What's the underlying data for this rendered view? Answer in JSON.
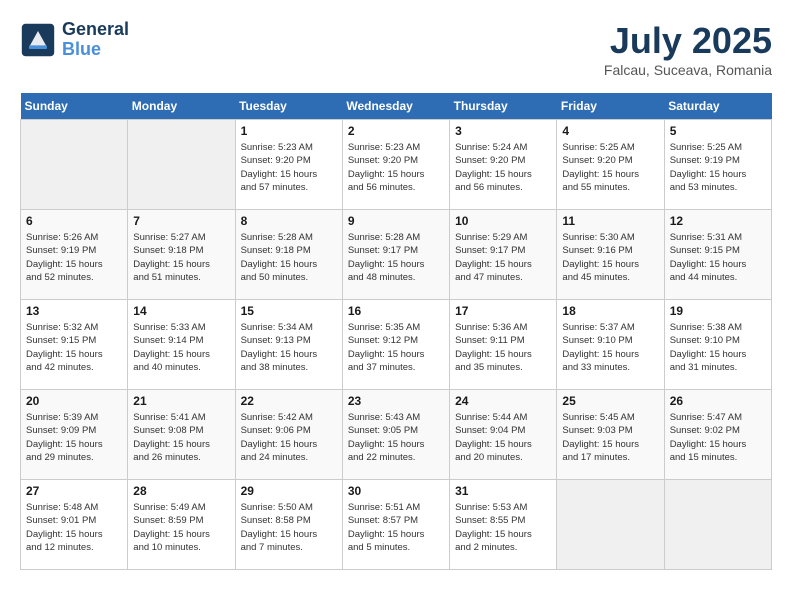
{
  "header": {
    "logo_line1": "General",
    "logo_line2": "Blue",
    "month": "July 2025",
    "location": "Falcau, Suceava, Romania"
  },
  "weekdays": [
    "Sunday",
    "Monday",
    "Tuesday",
    "Wednesday",
    "Thursday",
    "Friday",
    "Saturday"
  ],
  "weeks": [
    [
      {
        "day": "",
        "info": ""
      },
      {
        "day": "",
        "info": ""
      },
      {
        "day": "1",
        "info": "Sunrise: 5:23 AM\nSunset: 9:20 PM\nDaylight: 15 hours\nand 57 minutes."
      },
      {
        "day": "2",
        "info": "Sunrise: 5:23 AM\nSunset: 9:20 PM\nDaylight: 15 hours\nand 56 minutes."
      },
      {
        "day": "3",
        "info": "Sunrise: 5:24 AM\nSunset: 9:20 PM\nDaylight: 15 hours\nand 56 minutes."
      },
      {
        "day": "4",
        "info": "Sunrise: 5:25 AM\nSunset: 9:20 PM\nDaylight: 15 hours\nand 55 minutes."
      },
      {
        "day": "5",
        "info": "Sunrise: 5:25 AM\nSunset: 9:19 PM\nDaylight: 15 hours\nand 53 minutes."
      }
    ],
    [
      {
        "day": "6",
        "info": "Sunrise: 5:26 AM\nSunset: 9:19 PM\nDaylight: 15 hours\nand 52 minutes."
      },
      {
        "day": "7",
        "info": "Sunrise: 5:27 AM\nSunset: 9:18 PM\nDaylight: 15 hours\nand 51 minutes."
      },
      {
        "day": "8",
        "info": "Sunrise: 5:28 AM\nSunset: 9:18 PM\nDaylight: 15 hours\nand 50 minutes."
      },
      {
        "day": "9",
        "info": "Sunrise: 5:28 AM\nSunset: 9:17 PM\nDaylight: 15 hours\nand 48 minutes."
      },
      {
        "day": "10",
        "info": "Sunrise: 5:29 AM\nSunset: 9:17 PM\nDaylight: 15 hours\nand 47 minutes."
      },
      {
        "day": "11",
        "info": "Sunrise: 5:30 AM\nSunset: 9:16 PM\nDaylight: 15 hours\nand 45 minutes."
      },
      {
        "day": "12",
        "info": "Sunrise: 5:31 AM\nSunset: 9:15 PM\nDaylight: 15 hours\nand 44 minutes."
      }
    ],
    [
      {
        "day": "13",
        "info": "Sunrise: 5:32 AM\nSunset: 9:15 PM\nDaylight: 15 hours\nand 42 minutes."
      },
      {
        "day": "14",
        "info": "Sunrise: 5:33 AM\nSunset: 9:14 PM\nDaylight: 15 hours\nand 40 minutes."
      },
      {
        "day": "15",
        "info": "Sunrise: 5:34 AM\nSunset: 9:13 PM\nDaylight: 15 hours\nand 38 minutes."
      },
      {
        "day": "16",
        "info": "Sunrise: 5:35 AM\nSunset: 9:12 PM\nDaylight: 15 hours\nand 37 minutes."
      },
      {
        "day": "17",
        "info": "Sunrise: 5:36 AM\nSunset: 9:11 PM\nDaylight: 15 hours\nand 35 minutes."
      },
      {
        "day": "18",
        "info": "Sunrise: 5:37 AM\nSunset: 9:10 PM\nDaylight: 15 hours\nand 33 minutes."
      },
      {
        "day": "19",
        "info": "Sunrise: 5:38 AM\nSunset: 9:10 PM\nDaylight: 15 hours\nand 31 minutes."
      }
    ],
    [
      {
        "day": "20",
        "info": "Sunrise: 5:39 AM\nSunset: 9:09 PM\nDaylight: 15 hours\nand 29 minutes."
      },
      {
        "day": "21",
        "info": "Sunrise: 5:41 AM\nSunset: 9:08 PM\nDaylight: 15 hours\nand 26 minutes."
      },
      {
        "day": "22",
        "info": "Sunrise: 5:42 AM\nSunset: 9:06 PM\nDaylight: 15 hours\nand 24 minutes."
      },
      {
        "day": "23",
        "info": "Sunrise: 5:43 AM\nSunset: 9:05 PM\nDaylight: 15 hours\nand 22 minutes."
      },
      {
        "day": "24",
        "info": "Sunrise: 5:44 AM\nSunset: 9:04 PM\nDaylight: 15 hours\nand 20 minutes."
      },
      {
        "day": "25",
        "info": "Sunrise: 5:45 AM\nSunset: 9:03 PM\nDaylight: 15 hours\nand 17 minutes."
      },
      {
        "day": "26",
        "info": "Sunrise: 5:47 AM\nSunset: 9:02 PM\nDaylight: 15 hours\nand 15 minutes."
      }
    ],
    [
      {
        "day": "27",
        "info": "Sunrise: 5:48 AM\nSunset: 9:01 PM\nDaylight: 15 hours\nand 12 minutes."
      },
      {
        "day": "28",
        "info": "Sunrise: 5:49 AM\nSunset: 8:59 PM\nDaylight: 15 hours\nand 10 minutes."
      },
      {
        "day": "29",
        "info": "Sunrise: 5:50 AM\nSunset: 8:58 PM\nDaylight: 15 hours\nand 7 minutes."
      },
      {
        "day": "30",
        "info": "Sunrise: 5:51 AM\nSunset: 8:57 PM\nDaylight: 15 hours\nand 5 minutes."
      },
      {
        "day": "31",
        "info": "Sunrise: 5:53 AM\nSunset: 8:55 PM\nDaylight: 15 hours\nand 2 minutes."
      },
      {
        "day": "",
        "info": ""
      },
      {
        "day": "",
        "info": ""
      }
    ]
  ]
}
